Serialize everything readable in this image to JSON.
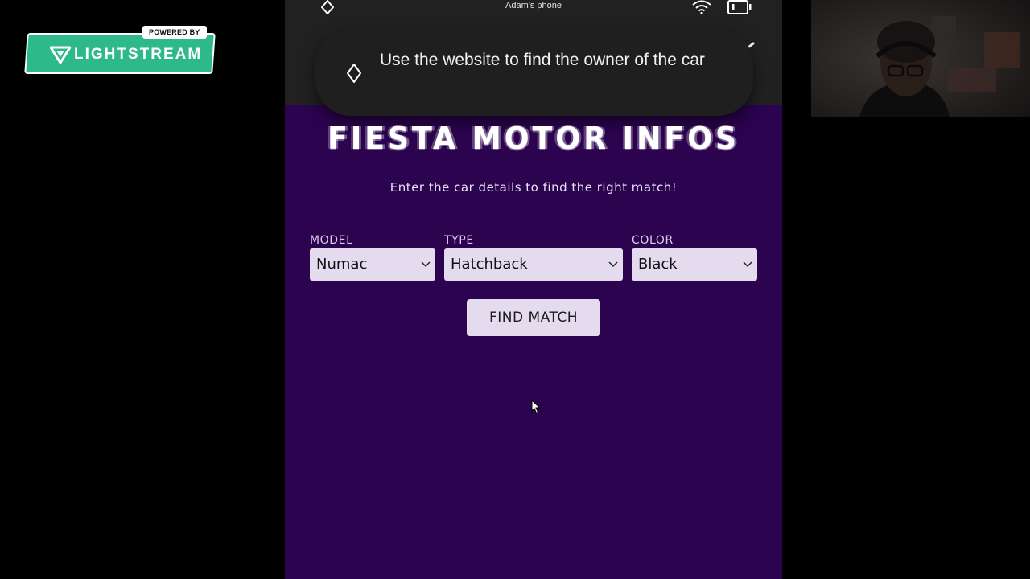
{
  "overlay": {
    "powered_by": "POWERED BY",
    "brand": "LIGHTSTREAM",
    "brand_color": "#2eb98a",
    "logo_icon": "lightstream-logo-icon"
  },
  "phone": {
    "device_name": "Adam's phone",
    "status_icons": [
      "diamond-icon",
      "wifi-icon",
      "cast-icon"
    ],
    "task": {
      "icon": "diamond-icon",
      "text": "Use the website to find the owner of the car"
    },
    "site": {
      "title": "FIESTA MOTOR INFOS",
      "subtitle": "Enter the car details to find the right match!",
      "background": "#2c034f",
      "fields": [
        {
          "label": "MODEL",
          "value": "Numac"
        },
        {
          "label": "TYPE",
          "value": "Hatchback"
        },
        {
          "label": "COLOR",
          "value": "Black"
        }
      ],
      "button_label": "FIND MATCH"
    }
  },
  "webcam": {
    "label": "streamer-webcam"
  }
}
